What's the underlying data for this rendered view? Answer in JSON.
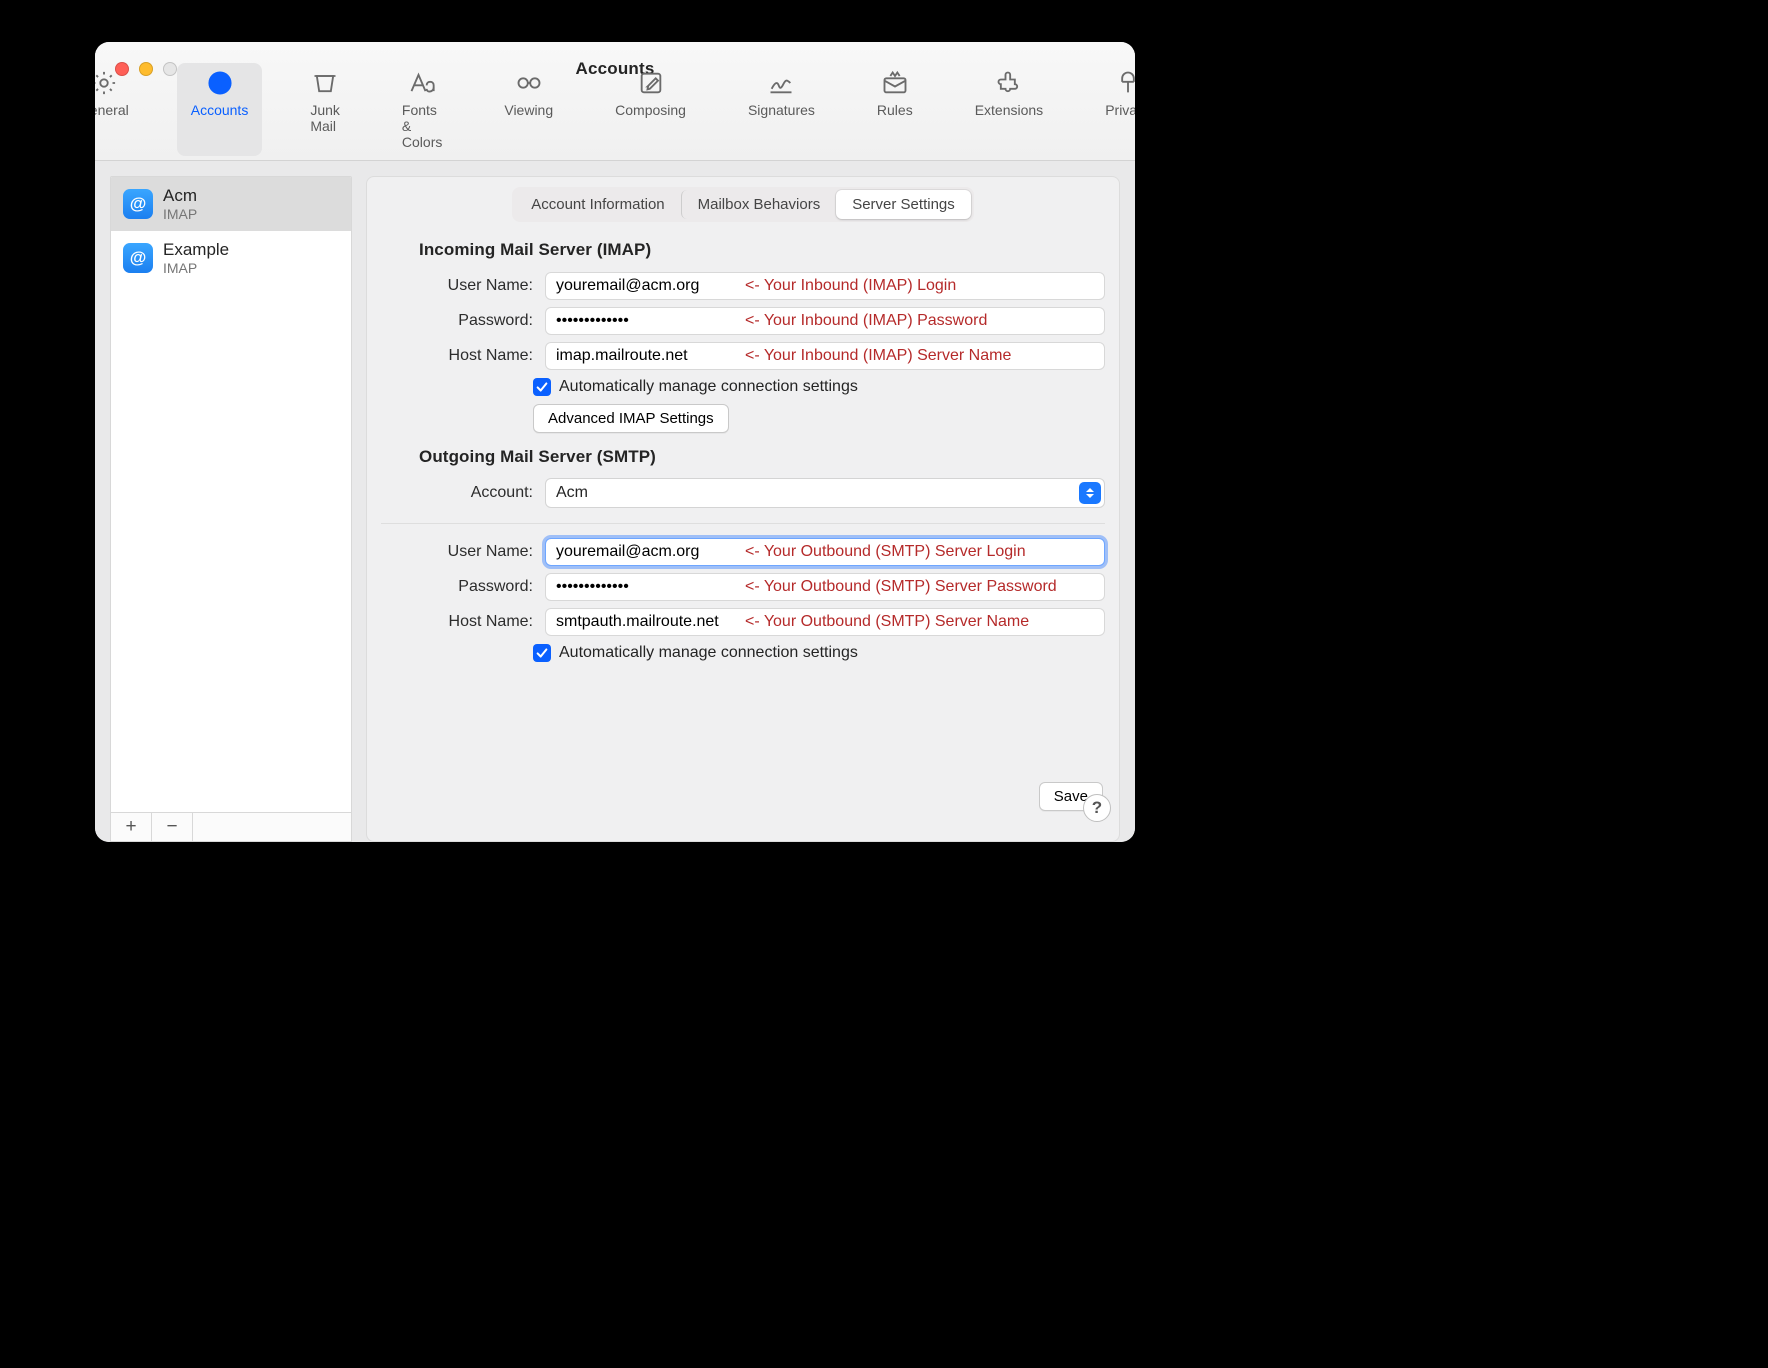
{
  "window": {
    "title": "Accounts"
  },
  "traffic_colors": [
    "#ff5f57",
    "#febc2e",
    "#e6e6e6"
  ],
  "toolbar": [
    {
      "id": "general",
      "label": "General"
    },
    {
      "id": "accounts",
      "label": "Accounts",
      "selected": true
    },
    {
      "id": "junk",
      "label": "Junk Mail"
    },
    {
      "id": "fonts",
      "label": "Fonts & Colors"
    },
    {
      "id": "viewing",
      "label": "Viewing"
    },
    {
      "id": "composing",
      "label": "Composing"
    },
    {
      "id": "signatures",
      "label": "Signatures"
    },
    {
      "id": "rules",
      "label": "Rules"
    },
    {
      "id": "extensions",
      "label": "Extensions"
    },
    {
      "id": "privacy",
      "label": "Privacy"
    }
  ],
  "sidebar": {
    "accounts": [
      {
        "name": "Acm",
        "sub": "IMAP",
        "selected": true
      },
      {
        "name": "Example",
        "sub": "IMAP"
      }
    ],
    "add": "+",
    "remove": "−"
  },
  "tabs": [
    {
      "label": "Account Information"
    },
    {
      "label": "Mailbox Behaviors"
    },
    {
      "label": "Server Settings",
      "active": true
    }
  ],
  "incoming": {
    "title": "Incoming Mail Server (IMAP)",
    "username_label": "User Name:",
    "username": "youremail@acm.org",
    "username_note": "<- Your Inbound (IMAP) Login",
    "password_label": "Password:",
    "password": "•••••••••••••",
    "password_note": "<- Your Inbound (IMAP) Password",
    "host_label": "Host Name:",
    "host": "imap.mailroute.net",
    "host_note": "<- Your Inbound (IMAP) Server Name",
    "auto": "Automatically manage connection settings",
    "advanced": "Advanced IMAP Settings"
  },
  "outgoing": {
    "title": "Outgoing Mail Server (SMTP)",
    "account_label": "Account:",
    "account": "Acm",
    "username_label": "User Name:",
    "username": "youremail@acm.org",
    "username_note": "<- Your Outbound (SMTP) Server Login",
    "password_label": "Password:",
    "password": "•••••••••••••",
    "password_note": "<- Your Outbound (SMTP) Server Password",
    "host_label": "Host Name:",
    "host": "smtpauth.mailroute.net",
    "host_note": "<- Your Outbound (SMTP) Server Name",
    "auto": "Automatically manage connection settings"
  },
  "save": "Save",
  "help": "?"
}
